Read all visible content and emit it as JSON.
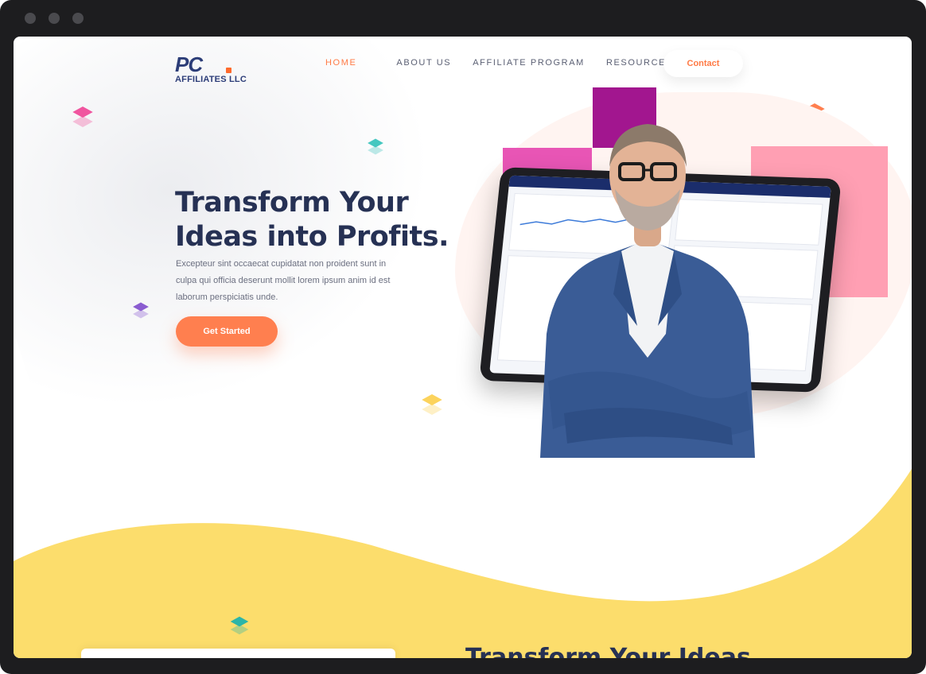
{
  "brand": {
    "logo_main": "PC",
    "logo_sub": "AFFILIATES LLC"
  },
  "nav": {
    "items": [
      {
        "label": "HOME",
        "active": true
      },
      {
        "label": "ABOUT US",
        "active": false
      },
      {
        "label": "AFFILIATE PROGRAM",
        "active": false
      },
      {
        "label": "RESOURCES",
        "active": false
      }
    ],
    "contact_label": "Contact"
  },
  "hero": {
    "title_line1": "Transform Your",
    "title_line2": "Ideas into Profits.",
    "body": "Excepteur sint occaecat cupidatat non proident sunt in culpa qui officia deserunt mollit lorem ipsum anim id est laborum perspiciatis unde.",
    "cta_label": "Get Started"
  },
  "section2": {
    "title": "Transform Your Ideas"
  },
  "colors": {
    "accent": "#ff7f4f",
    "navy": "#263154",
    "brand_navy": "#2c3d78",
    "yellow": "#fcdd6c",
    "purple": "#a2168f",
    "pink": "#e855b5",
    "rose": "#ff9fb3"
  }
}
